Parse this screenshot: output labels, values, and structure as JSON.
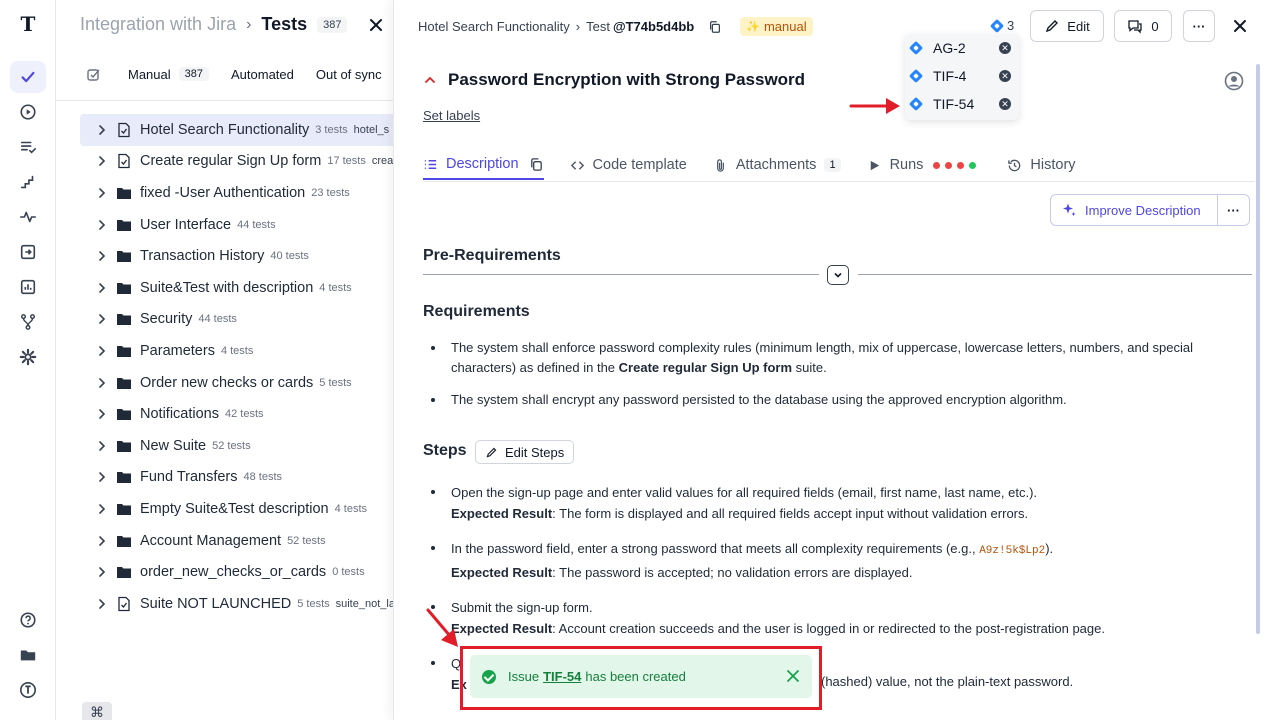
{
  "rail": {
    "logo_letter": "T",
    "items": [
      "check-icon",
      "play-circle-icon",
      "list-check-icon",
      "steps-icon",
      "pulse-icon",
      "import-icon",
      "chart-icon",
      "branch-icon",
      "gear-icon"
    ],
    "bottom": [
      "help-icon",
      "folder-icon",
      "account-icon"
    ]
  },
  "tree": {
    "project": "Integration with Jira",
    "separator": "›",
    "current": "Tests",
    "count": "387",
    "tabs": [
      {
        "label": "Manual",
        "count": "387"
      },
      {
        "label": "Automated"
      },
      {
        "label": "Out of sync"
      }
    ],
    "rows": [
      {
        "name": "Hotel Search Functionality",
        "count": "3 tests",
        "extra": "hotel_s",
        "icon": "suite",
        "selected": true
      },
      {
        "name": "Create regular Sign Up form",
        "count": "17 tests",
        "extra": "crea",
        "icon": "suite"
      },
      {
        "name": "fixed -User Authentication",
        "count": "23 tests",
        "icon": "folder"
      },
      {
        "name": "User Interface",
        "count": "44 tests",
        "icon": "folder"
      },
      {
        "name": "Transaction History",
        "count": "40 tests",
        "icon": "folder"
      },
      {
        "name": "Suite&Test with description",
        "count": "4 tests",
        "icon": "folder"
      },
      {
        "name": "Security",
        "count": "44 tests",
        "icon": "folder"
      },
      {
        "name": "Parameters",
        "count": "4 tests",
        "icon": "folder"
      },
      {
        "name": "Order new checks or cards",
        "count": "5 tests",
        "icon": "folder"
      },
      {
        "name": "Notifications",
        "count": "42 tests",
        "icon": "folder"
      },
      {
        "name": "New Suite",
        "count": "52 tests",
        "icon": "folder"
      },
      {
        "name": "Fund Transfers",
        "count": "48 tests",
        "icon": "folder"
      },
      {
        "name": "Empty Suite&Test description",
        "count": "4 tests",
        "icon": "folder"
      },
      {
        "name": "Account Management",
        "count": "52 tests",
        "icon": "folder"
      },
      {
        "name": "order_new_checks_or_cards",
        "count": "0 tests",
        "icon": "folder"
      },
      {
        "name": "Suite NOT LAUNCHED",
        "count": "5 tests",
        "extra": "suite_not_lau",
        "icon": "suite"
      }
    ],
    "kbd": "⌘"
  },
  "detail": {
    "suite": "Hotel Search Functionality",
    "sep": "›",
    "test_prefix": "Test",
    "test_code": "@T74b5d4bb",
    "badge": "manual",
    "jira_count": "3",
    "edit_label": "Edit",
    "comments_count": "0",
    "more_label": "···",
    "jira_issues": [
      "AG-2",
      "TIF-4",
      "TIF-54"
    ],
    "title": "Password Encryption with Strong Password",
    "set_labels": "Set labels",
    "tabs": {
      "description": "Description",
      "code": "Code template",
      "attachments": "Attachments",
      "attachments_count": "1",
      "runs": "Runs",
      "history": "History"
    },
    "run_dots": [
      "#ef4444",
      "#ef4444",
      "#ef4444",
      "#22c55e"
    ],
    "improve_label": "Improve Description",
    "improve_more": "···",
    "pre_req": "Pre-Requirements",
    "requirements": "Requirements",
    "req1_a": "The system shall enforce password complexity rules (minimum length, mix of uppercase, lowercase letters, numbers, and special characters) as defined in the ",
    "req1_b": "Create regular Sign Up form",
    "req1_c": " suite.",
    "req2": "The system shall encrypt any password persisted to the database using the approved encryption algorithm.",
    "steps": "Steps",
    "edit_steps": "Edit Steps",
    "expected_label": "Expected Result",
    "step1": "Open the sign-up page and enter valid values for all required fields (email, first name, last name, etc.).",
    "exp1": ": The form is displayed and all required fields accept input without validation errors.",
    "step2_a": "In the password field, enter a strong password that meets all complexity requirements (e.g., ",
    "step2_code": "A9z!5k$Lp2",
    "step2_b": ").",
    "exp2": ": The password is accepted; no validation errors are displayed.",
    "step3": "Submit the sign-up form.",
    "exp3": ": Account creation succeeds and the user is logged in or redirected to the post-registration page.",
    "step4_start": "Q",
    "exp4_start": "Ex",
    "exp4_tail": "(hashed) value, not the plain-text password."
  },
  "toast": {
    "prefix": "Issue",
    "issue": "TIF-54",
    "suffix": "has been created"
  },
  "colors": {
    "accent": "#4f46e5",
    "jira": "#2684ff",
    "annotation": "#e11d2a",
    "success": "#16a34a"
  }
}
